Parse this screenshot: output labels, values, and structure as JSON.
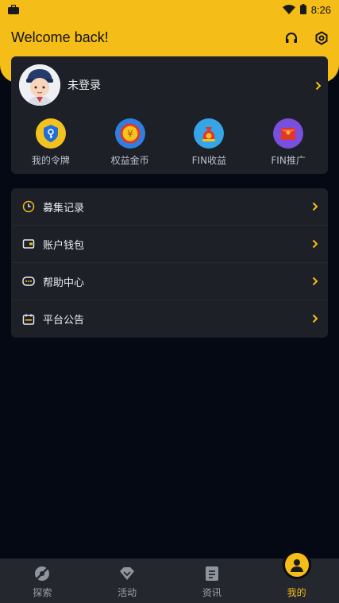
{
  "status_bar": {
    "time": "8:26",
    "icons": [
      "briefcase-icon",
      "wifi-icon",
      "battery-icon"
    ]
  },
  "header": {
    "welcome": "Welcome back!",
    "icons": [
      "headset-icon",
      "settings-icon"
    ]
  },
  "profile": {
    "name": "未登录",
    "quick_actions": [
      {
        "label": "我的令牌",
        "icon": "shield-token-icon"
      },
      {
        "label": "权益金币",
        "icon": "gold-coin-icon"
      },
      {
        "label": "FIN收益",
        "icon": "money-bag-icon"
      },
      {
        "label": "FIN推广",
        "icon": "red-envelope-icon"
      }
    ]
  },
  "menu": [
    {
      "label": "募集记录",
      "icon": "clock-icon"
    },
    {
      "label": "账户钱包",
      "icon": "wallet-icon"
    },
    {
      "label": "帮助中心",
      "icon": "chat-icon"
    },
    {
      "label": "平台公告",
      "icon": "calendar-icon"
    }
  ],
  "bottom_nav": [
    {
      "label": "探索",
      "icon": "explore-icon"
    },
    {
      "label": "活动",
      "icon": "diamond-icon"
    },
    {
      "label": "资讯",
      "icon": "document-icon"
    },
    {
      "label": "我的",
      "icon": "user-icon",
      "active": true
    }
  ],
  "colors": {
    "accent": "#f4bd17",
    "background": "#050914",
    "card": "#1d2027",
    "nav": "#24272d"
  }
}
